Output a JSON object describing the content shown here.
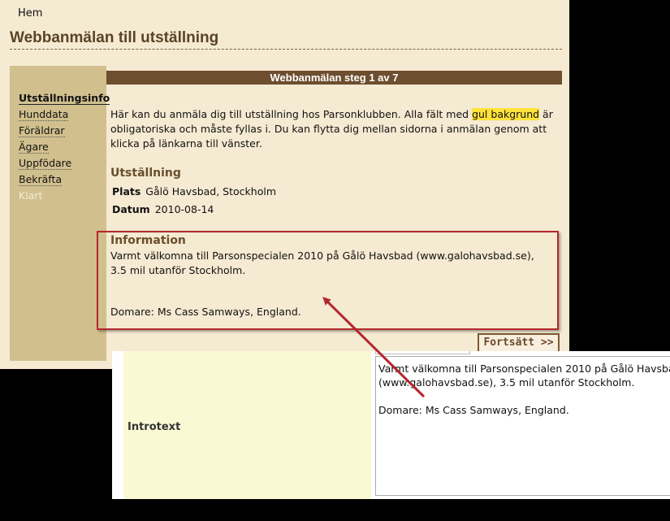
{
  "nav": {
    "home_label": "Hem"
  },
  "page_title": "Webbanmälan till utställning",
  "sidebar": {
    "items": [
      {
        "label": "Utställningsinfo"
      },
      {
        "label": "Hunddata"
      },
      {
        "label": "Föräldrar"
      },
      {
        "label": "Ägare"
      },
      {
        "label": "Uppfödare"
      },
      {
        "label": "Bekräfta"
      },
      {
        "label": "Klart"
      }
    ]
  },
  "step_header": "Webbanmälan steg 1 av 7",
  "intro": {
    "before": "Här kan du anmäla dig till utställning hos Parsonklubben. Alla fält med ",
    "highlight": "gul bakgrund",
    "after": " är obligatoriska och måste fyllas i. Du kan flytta dig mellan sidorna i anmälan genom att klicka på länkarna till vänster."
  },
  "utstallning": {
    "heading": "Utställning",
    "plats_label": "Plats",
    "plats_value": "Gålö Havsbad, Stockholm",
    "datum_label": "Datum",
    "datum_value": "2010-08-14"
  },
  "information": {
    "heading": "Information",
    "text": "Varmt välkomna till Parsonspecialen 2010 på Gålö Havsbad (www.galohavsbad.se), 3.5 mil utanför Stockholm.",
    "domare": "Domare: Ms Cass Samways, England."
  },
  "continue_label": "Fortsätt >>",
  "inset": {
    "label": "Introtext",
    "textarea_value": "Varmt välkomna till Parsonspecialen 2010 på Gålö Havsbad\n(www.galohavsbad.se), 3.5 mil utanför Stockholm.\n\nDomare: Ms Cass Samways, England."
  },
  "colors": {
    "page_bg": "#f5ead2",
    "sidebar_bg": "#d1c08e",
    "header_bar": "#6d4e2e",
    "highlight": "#ffe23a",
    "callout": "#b2282e"
  }
}
